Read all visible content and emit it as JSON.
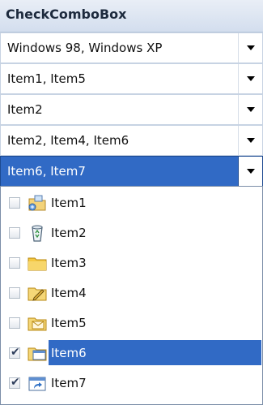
{
  "header": {
    "title": "CheckComboBox"
  },
  "combos": [
    {
      "text": "Windows 98, Windows XP"
    },
    {
      "text": "Item1, Item5"
    },
    {
      "text": "Item2"
    },
    {
      "text": "Item2, Item4, Item6"
    },
    {
      "text": "Item6, Item7"
    }
  ],
  "dropdown": {
    "items": [
      {
        "label": "Item1",
        "icon": "network-folder-icon",
        "checked": false
      },
      {
        "label": "Item2",
        "icon": "recycle-bin-icon",
        "checked": false
      },
      {
        "label": "Item3",
        "icon": "folder-icon",
        "checked": false
      },
      {
        "label": "Item4",
        "icon": "edit-folder-icon",
        "checked": false
      },
      {
        "label": "Item5",
        "icon": "mail-folder-icon",
        "checked": false
      },
      {
        "label": "Item6",
        "icon": "window-folder-icon",
        "checked": true,
        "selected": true
      },
      {
        "label": "Item7",
        "icon": "shortcut-window-icon",
        "checked": true
      }
    ]
  },
  "colors": {
    "selection": "#316ac5",
    "header_bg": "#d3deee"
  }
}
